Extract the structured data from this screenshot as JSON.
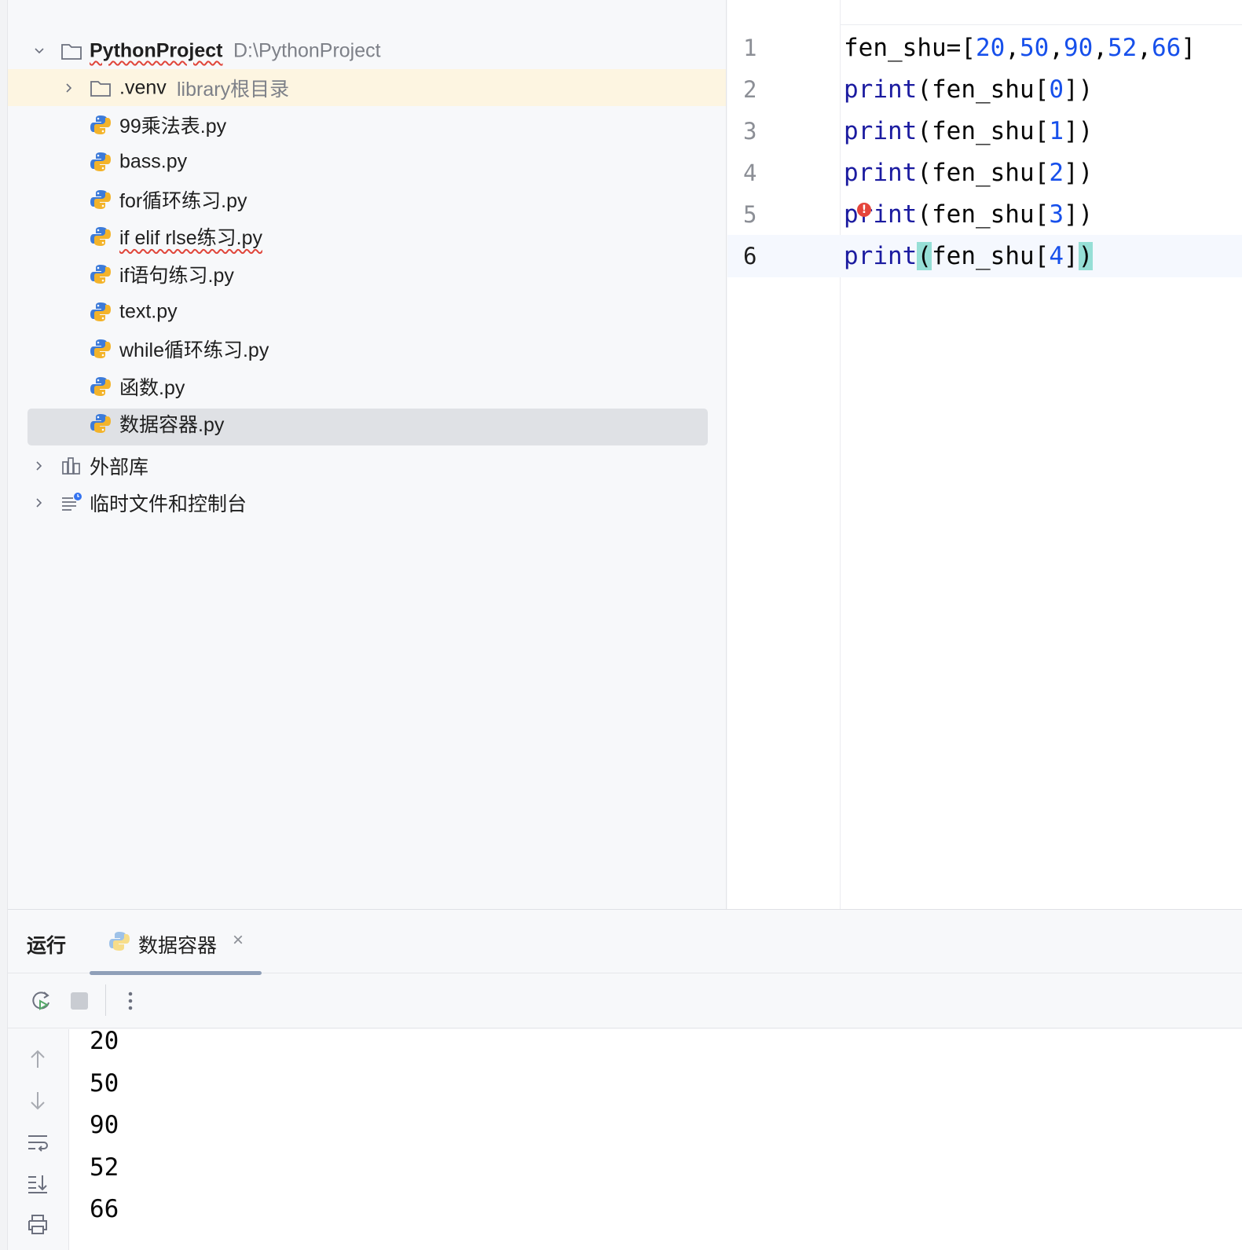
{
  "project_tree": {
    "root": {
      "name": "PythonProject",
      "path": "D:\\PythonProject"
    },
    "venv": {
      "name": ".venv",
      "hint": "library根目录"
    },
    "files": [
      "99乘法表.py",
      "bass.py",
      "for循环练习.py",
      "if elif rlse练习.py",
      "if语句练习.py",
      "text.py",
      "while循环练习.py",
      "函数.py",
      "数据容器.py"
    ],
    "external_libraries": "外部库",
    "scratches": "临时文件和控制台"
  },
  "editor": {
    "line_numbers": [
      "1",
      "2",
      "3",
      "4",
      "5",
      "6"
    ],
    "current_line": 6,
    "lines": [
      {
        "parts": [
          [
            "fen_shu=[",
            "plain"
          ],
          [
            "20",
            "num"
          ],
          [
            ",",
            "plain"
          ],
          [
            "50",
            "num"
          ],
          [
            ",",
            "plain"
          ],
          [
            "90",
            "num"
          ],
          [
            ",",
            "plain"
          ],
          [
            "52",
            "num"
          ],
          [
            ",",
            "plain"
          ],
          [
            "66",
            "num"
          ],
          [
            "]",
            "plain"
          ]
        ]
      },
      {
        "parts": [
          [
            "print",
            "kw"
          ],
          [
            "(fen_shu[",
            "plain"
          ],
          [
            "0",
            "num"
          ],
          [
            "])",
            "plain"
          ]
        ]
      },
      {
        "parts": [
          [
            "print",
            "kw"
          ],
          [
            "(fen_shu[",
            "plain"
          ],
          [
            "1",
            "num"
          ],
          [
            "])",
            "plain"
          ]
        ]
      },
      {
        "parts": [
          [
            "print",
            "kw"
          ],
          [
            "(fen_shu[",
            "plain"
          ],
          [
            "2",
            "num"
          ],
          [
            "])",
            "plain"
          ]
        ]
      },
      {
        "parts": [
          [
            "print",
            "kw"
          ],
          [
            "(fen_shu[",
            "plain"
          ],
          [
            "3",
            "num"
          ],
          [
            "])",
            "plain"
          ]
        ]
      },
      {
        "parts": [
          [
            "print",
            "kw"
          ],
          [
            "(",
            "brh"
          ],
          [
            "fen_shu[",
            "plain"
          ],
          [
            "4",
            "num"
          ],
          [
            "]",
            "plain"
          ],
          [
            ")",
            "brh"
          ]
        ]
      }
    ]
  },
  "run_panel": {
    "title": "运行",
    "tab_label": "数据容器",
    "output": [
      "20",
      "50",
      "90",
      "52",
      "66"
    ]
  },
  "colors": {
    "keyword": "#1b1ba0",
    "number": "#1750eb",
    "bracket_highlight": "#96dfd6",
    "error": "#e5453b",
    "selection": "#dfe1e5",
    "venv_row": "#fdf5e1"
  }
}
